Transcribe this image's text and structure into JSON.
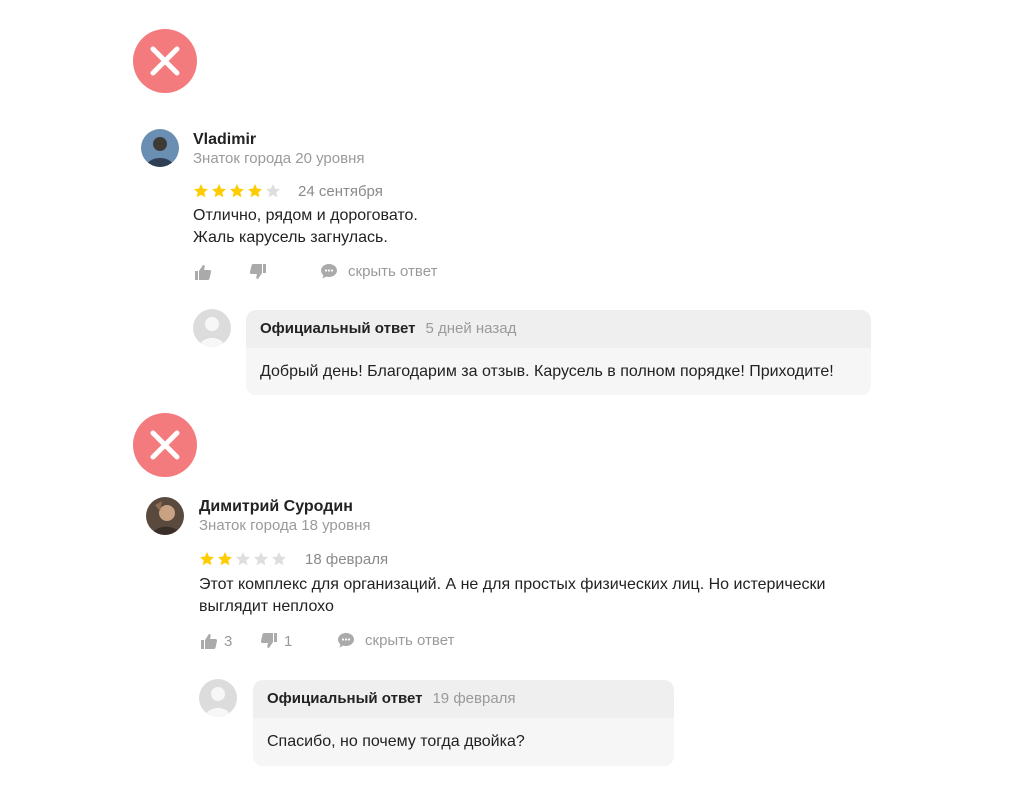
{
  "colors": {
    "accent_star": "#ffcc00",
    "star_empty": "#dedede",
    "reject_mark": "#f47b7d",
    "muted_text": "#9a9a9a",
    "reply_bg": "#efefef"
  },
  "reviews": [
    {
      "author": "Vladimir",
      "level": "Знаток города 20 уровня",
      "rating": 4,
      "date": "24 сентября",
      "text_lines": [
        "Отлично, рядом и дороговато.",
        "Жаль карусель загнулась."
      ],
      "likes": "",
      "dislikes": "",
      "hide_reply": "скрыть ответ",
      "reply": {
        "label": "Официальный ответ",
        "date": "5 дней назад",
        "text": "Добрый день! Благодарим за отзыв. Карусель в полном порядке! Приходите!"
      }
    },
    {
      "author": "Димитрий Суродин",
      "level": "Знаток города 18 уровня",
      "rating": 2,
      "date": "18 февраля",
      "text_lines": [
        "Этот комплекс для организаций. А не для простых физических лиц. Но истерически",
        "выглядит неплохо"
      ],
      "likes": "3",
      "dislikes": "1",
      "hide_reply": "скрыть ответ",
      "reply": {
        "label": "Официальный ответ",
        "date": "19 февраля",
        "text": "Спасибо, но почему тогда двойка?"
      }
    }
  ]
}
